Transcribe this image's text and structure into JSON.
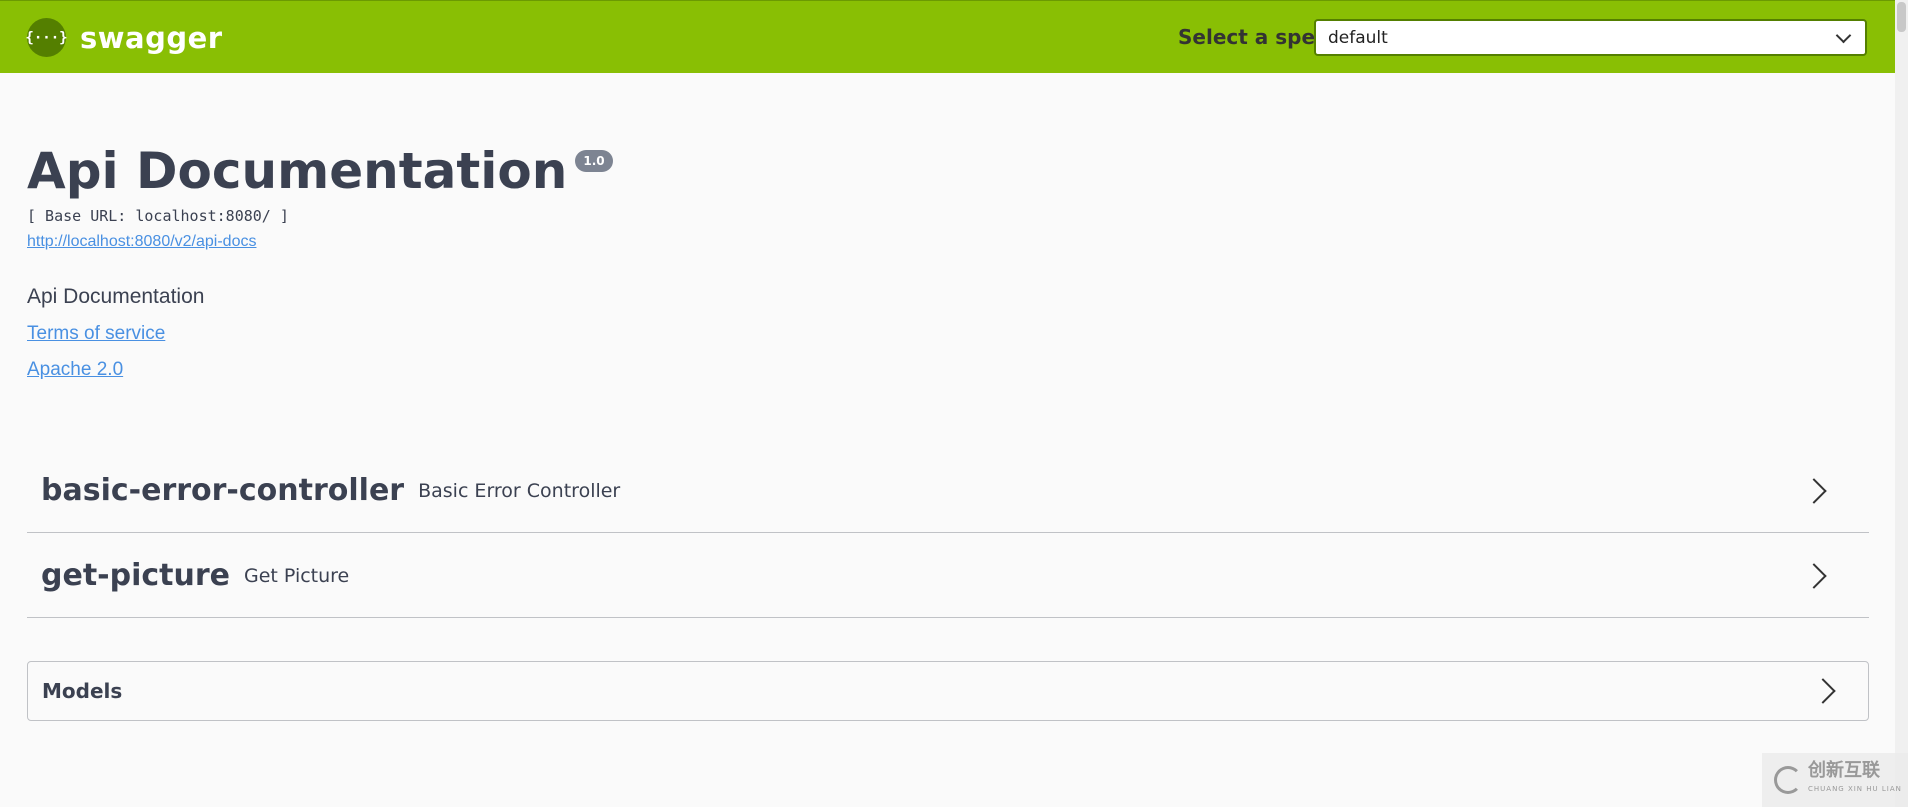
{
  "topbar": {
    "logo_glyph": "{···}",
    "brand": "swagger",
    "spec_label": "Select a spec",
    "spec_selected": "default"
  },
  "info": {
    "title": "Api Documentation",
    "version": "1.0",
    "base_url": "[ Base URL: localhost:8080/ ]",
    "api_docs_link": "http://localhost:8080/v2/api-docs",
    "description": "Api Documentation",
    "terms_of_service": "Terms of service",
    "license": "Apache 2.0"
  },
  "tags": [
    {
      "name": "basic-error-controller",
      "description": "Basic Error Controller"
    },
    {
      "name": "get-picture",
      "description": "Get Picture"
    }
  ],
  "models": {
    "label": "Models"
  },
  "watermark": {
    "text": "创新互联",
    "sub": "CHUANG XIN HU LIAN"
  },
  "colors": {
    "topbar": "#89bf04",
    "link": "#4990e2",
    "text": "#3b4151"
  },
  "icons": {
    "logo": "swagger-logo-icon",
    "spec_dropdown": "chevron-down-icon",
    "tag_expand": "chevron-right-icon",
    "watermark": "watermark-logo-icon"
  }
}
